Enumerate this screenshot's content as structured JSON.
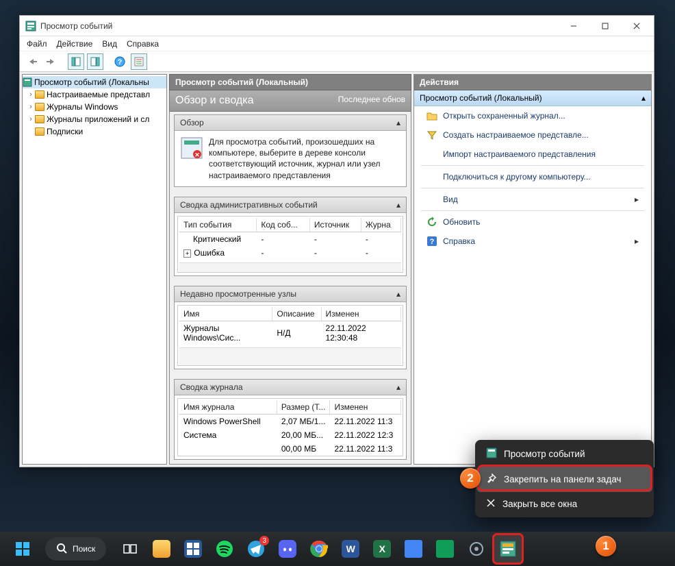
{
  "window": {
    "title": "Просмотр событий",
    "menubar": [
      "Файл",
      "Действие",
      "Вид",
      "Справка"
    ]
  },
  "tree": {
    "root": "Просмотр событий (Локальны",
    "items": [
      "Настраиваемые представл",
      "Журналы Windows",
      "Журналы приложений и сл",
      "Подписки"
    ]
  },
  "middle": {
    "header": "Просмотр событий (Локальный)",
    "subtitle": "Обзор и сводка",
    "updated": "Последнее обнов",
    "overview": {
      "head": "Обзор",
      "text": "Для просмотра событий, произошедших на компьютере, выберите в дереве консоли соответствующий источник, журнал или узел настраиваемого представления"
    },
    "admin": {
      "head": "Сводка административных событий",
      "cols": [
        "Тип события",
        "Код соб...",
        "Источник",
        "Журна"
      ],
      "rows": [
        [
          "Критический",
          "-",
          "-",
          "-"
        ],
        [
          "Ошибка",
          "-",
          "-",
          "-"
        ]
      ]
    },
    "recent": {
      "head": "Недавно просмотренные узлы",
      "cols": [
        "Имя",
        "Описание",
        "Изменен"
      ],
      "rows": [
        [
          "Журналы Windows\\Сис...",
          "Н/Д",
          "22.11.2022 12:30:48"
        ]
      ]
    },
    "summary": {
      "head": "Сводка журнала",
      "cols": [
        "Имя журнала",
        "Размер (Т...",
        "Изменен"
      ],
      "rows": [
        [
          "Windows PowerShell",
          "2,07 МБ/1...",
          "22.11.2022 11:3"
        ],
        [
          "Система",
          "20,00 МБ...",
          "22.11.2022 12:3"
        ],
        [
          "",
          "00,00 МБ",
          "22.11.2022 11:3"
        ]
      ]
    }
  },
  "actions": {
    "head": "Действия",
    "group": "Просмотр событий (Локальный)",
    "items": [
      "Открыть сохраненный журнал...",
      "Создать настраиваемое представле...",
      "Импорт настраиваемого представления",
      "Подключиться к другому компьютеру...",
      "Вид",
      "Обновить",
      "Справка"
    ]
  },
  "jumplist": {
    "app": "Просмотр событий",
    "pin": "Закрепить на панели задач",
    "close": "Закрыть все окна"
  },
  "taskbar": {
    "search": "Поиск"
  },
  "annotations": {
    "badge1": "1",
    "badge2": "2"
  }
}
